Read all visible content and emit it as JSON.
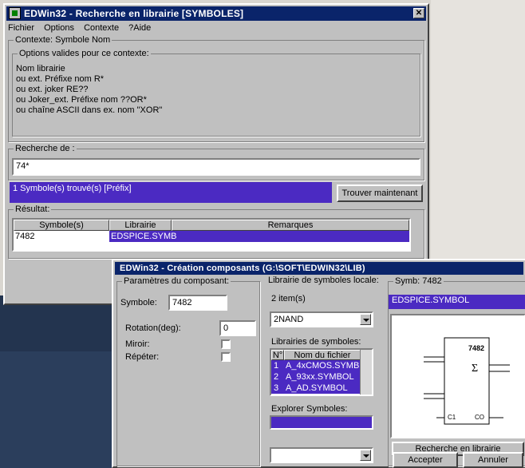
{
  "search_window": {
    "title": "EDWin32 - Recherche en librairie [SYMBOLES]",
    "close_label": "✕",
    "menu": [
      "Fichier",
      "Options",
      "Contexte",
      "?Aide"
    ],
    "context_group_label": "Contexte: Symbole Nom",
    "options_group_label": "Options valides pour ce contexte:",
    "options_lines": [
      "Nom librairie",
      "ou ext. Préfixe nom R*",
      "ou ext. joker RE??",
      "ou Joker_ext. Préfixe nom ??OR*",
      "ou chaîne ASCII dans ex. nom \"XOR\""
    ],
    "search_group_label": "Recherche de :",
    "search_value": "74*",
    "status_text": "1 Symbole(s) trouvé(s) [Préfix]",
    "find_button": "Trouver maintenant",
    "result_group_label": "Résultat:",
    "columns": [
      "Symbole(s)",
      "Librairie",
      "Remarques"
    ],
    "rows": [
      {
        "symbol": "7482",
        "library": "EDSPICE.SYMB",
        "remarks": ""
      }
    ]
  },
  "create_window": {
    "title": "EDWin32 - Création composants (G:\\SOFT\\EDWIN32\\LIB)",
    "params_group_label": "Paramètres du composant:",
    "symbol_label": "Symbole:",
    "symbol_value": "7482",
    "rotation_label": "Rotation(deg):",
    "rotation_value": "0",
    "mirror_label": "Miroir:",
    "repeat_label": "Répéter:",
    "local_lib_group_label": "Librairie de symboles locale:",
    "items_count": "2 item(s)",
    "local_select_value": "2NAND",
    "libraries_group_label": "Librairies de symboles:",
    "lib_columns": [
      "N°",
      "Nom du fichier"
    ],
    "lib_rows": [
      {
        "n": "1",
        "name": "A_4xCMOS.SYMB"
      },
      {
        "n": "2",
        "name": "A_93xx.SYMBOL"
      },
      {
        "n": "3",
        "name": "A_AD.SYMBOL"
      }
    ],
    "explore_group_label": "Explorer Symboles:",
    "preview_label": "Symb: 7482",
    "preview_lib": "EDSPICE.SYMBOL",
    "chip": {
      "part": "7482",
      "pin_c1": "C1",
      "pin_co": "CO",
      "sum": "Σ"
    },
    "search_lib_button": "Recherche en librairie",
    "accept_button": "Accepter",
    "cancel_button": "Annuler"
  }
}
